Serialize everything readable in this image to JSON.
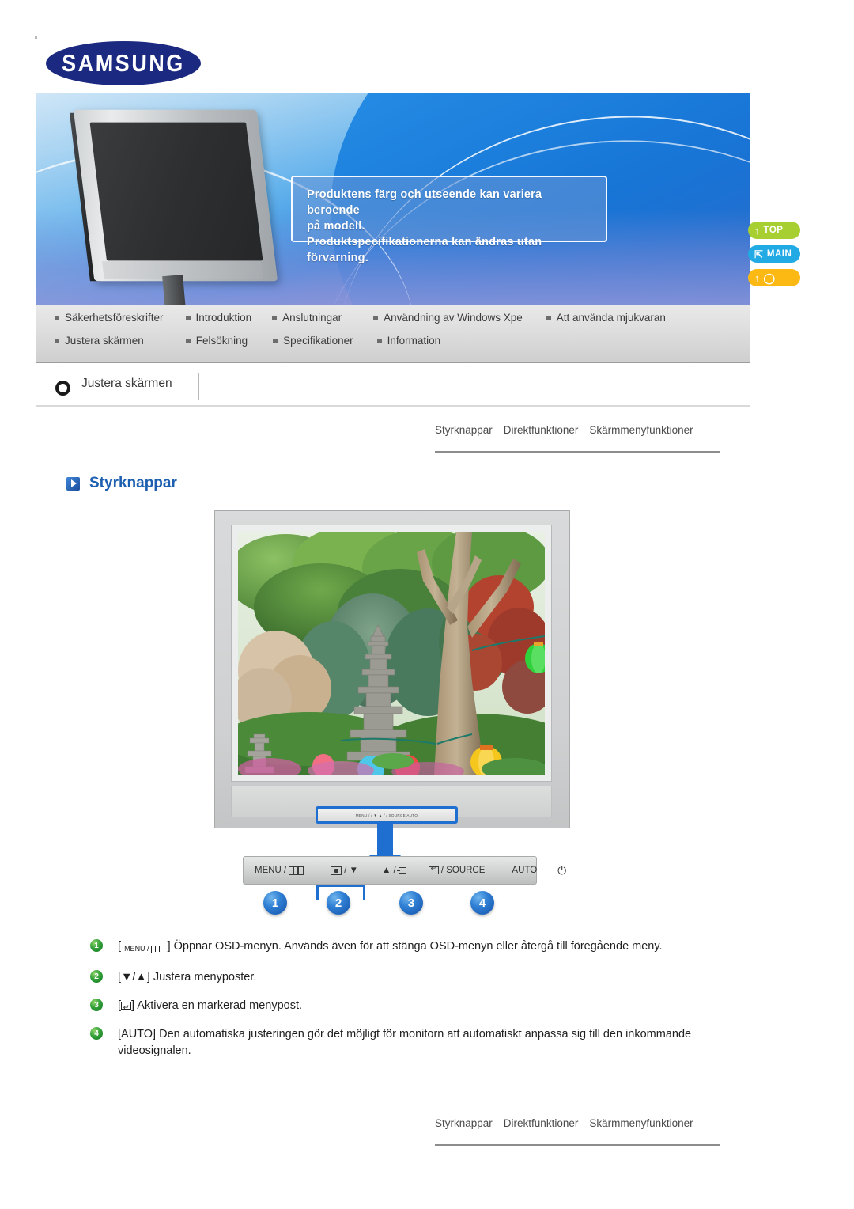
{
  "brand": {
    "logo_text": "SAMSUNG"
  },
  "banner": {
    "callout_lines": [
      "Produktens färg och utseende kan variera beroende",
      "på modell.",
      "Produktspecifikationerna kan ändras utan förvarning."
    ],
    "product_illustration": "lcd-monitor"
  },
  "nav": {
    "row1": [
      "Säkerhetsföreskrifter",
      "Introduktion",
      "Anslutningar",
      "Användning av Windows Xpe",
      "Att använda mjukvaran"
    ],
    "row2": [
      "Justera skärmen",
      "Felsökning",
      "Specifikationer",
      "Information"
    ]
  },
  "side_buttons": [
    {
      "label": "TOP",
      "icon": "arrow-up-icon",
      "color": "#a8cf32"
    },
    {
      "label": "MAIN",
      "icon": "arrow-turn-icon",
      "color": "#22aae4"
    },
    {
      "label": "",
      "icon": "arrow-up-book-icon",
      "color": "#fcb813"
    }
  ],
  "page_title": {
    "text": "Justera skärmen",
    "icon": "ring-icon"
  },
  "subnav": {
    "items": [
      "Styrknappar",
      "Direktfunktioner",
      "Skärmmenyfunktioner"
    ]
  },
  "section": {
    "heading": "Styrknappar",
    "icon": "blue-play-icon"
  },
  "figure": {
    "caption": "",
    "button_strip_mini": "MENU /     / ▼   ▲ /     / SOURCE   AUTO"
  },
  "control_bar": {
    "keys": [
      {
        "label": "MENU /",
        "icon": "menu-grid-icon"
      },
      {
        "label": "/ ▼",
        "icon": "input-box-icon"
      },
      {
        "label": "▲ /",
        "icon": "small-box-icon"
      },
      {
        "label": "/ SOURCE",
        "icon": "enter-box-icon"
      },
      {
        "label": "AUTO",
        "icon": ""
      },
      {
        "label": "",
        "icon": "power-icon"
      }
    ],
    "key1_label": "MENU /",
    "key2_label": "/ ▼",
    "key3_label": "▲ /",
    "key4_label": "/ SOURCE",
    "key5_label": "AUTO",
    "power_glyph": "⏻"
  },
  "number_markers": [
    "1",
    "2",
    "3",
    "4"
  ],
  "descriptions": [
    {
      "num": "1",
      "prefix": "[",
      "menu_word": "MENU /",
      "suffix": "] Öppnar OSD-menyn. Används även för att stänga OSD-menyn eller återgå till föregående meny."
    },
    {
      "num": "2",
      "text": "[▼/▲] Justera menyposter."
    },
    {
      "num": "3",
      "prefix": "[",
      "suffix": "] Aktivera en markerad menypost."
    },
    {
      "num": "4",
      "text": "[AUTO] Den automatiska justeringen gör det möjligt för monitorn att automatiskt anpassa sig till den inkommande videosignalen."
    }
  ],
  "colors": {
    "heading_blue": "#1d5fb0",
    "accent_blue": "#1f6fd0",
    "green_badge": "#34a13a",
    "top_green": "#a8cf32",
    "main_blue": "#22aae4",
    "back_orange": "#fcb813",
    "samsung_navy": "#1b2a80"
  }
}
